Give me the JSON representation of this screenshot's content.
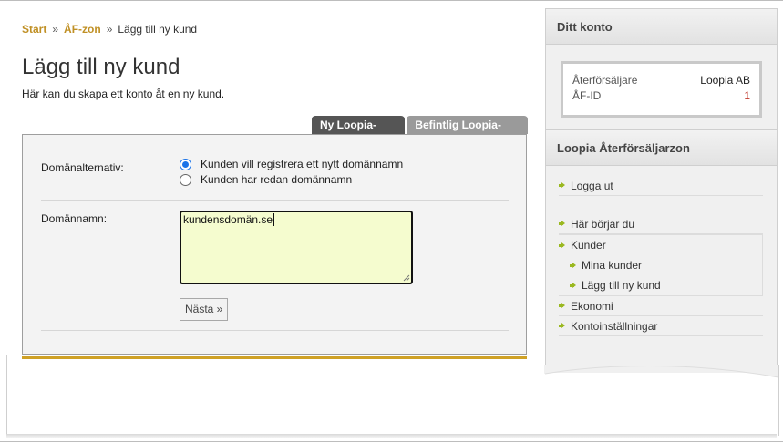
{
  "breadcrumb": {
    "items": [
      {
        "label": "Start",
        "link": true
      },
      {
        "label": "ÅF-zon",
        "link": true
      },
      {
        "label": "Lägg till ny kund",
        "link": false
      }
    ],
    "separator": "»"
  },
  "page": {
    "title": "Lägg till ny kund",
    "description": "Här kan du skapa ett konto åt en ny kund."
  },
  "tabs": [
    {
      "label": "Ny Loopia-kund",
      "active": true
    },
    {
      "label": "Befintlig Loopia-kund",
      "active": false
    }
  ],
  "form": {
    "domain_option_label": "Domänalternativ:",
    "radio_new": "Kunden vill registrera ett nytt domännamn",
    "radio_existing": "Kunden har redan domännamn",
    "domain_label": "Domännamn:",
    "domain_value": "kundensdomän.se",
    "next_label": "Nästa »"
  },
  "sidebar": {
    "account_title": "Ditt konto",
    "account": {
      "reseller_key": "Återförsäljare",
      "reseller_value": "Loopia AB",
      "id_key": "ÅF-ID",
      "id_value": "1"
    },
    "zone_title": "Loopia Återförsäljarzon",
    "nav": {
      "logout": "Logga ut",
      "start_here": "Här börjar du",
      "customers": "Kunder",
      "my_customers": "Mina kunder",
      "add_customer": "Lägg till ny kund",
      "economy": "Ekonomi",
      "account_settings": "Kontoinställningar"
    }
  },
  "colors": {
    "link_gold": "#c09025",
    "accent_bar": "#cfa126",
    "tab_active": "#555555",
    "tab_inactive": "#9a9a9a",
    "input_bg": "#f5fccf",
    "arrow_green": "#9ab820",
    "id_red": "#c0392b"
  }
}
